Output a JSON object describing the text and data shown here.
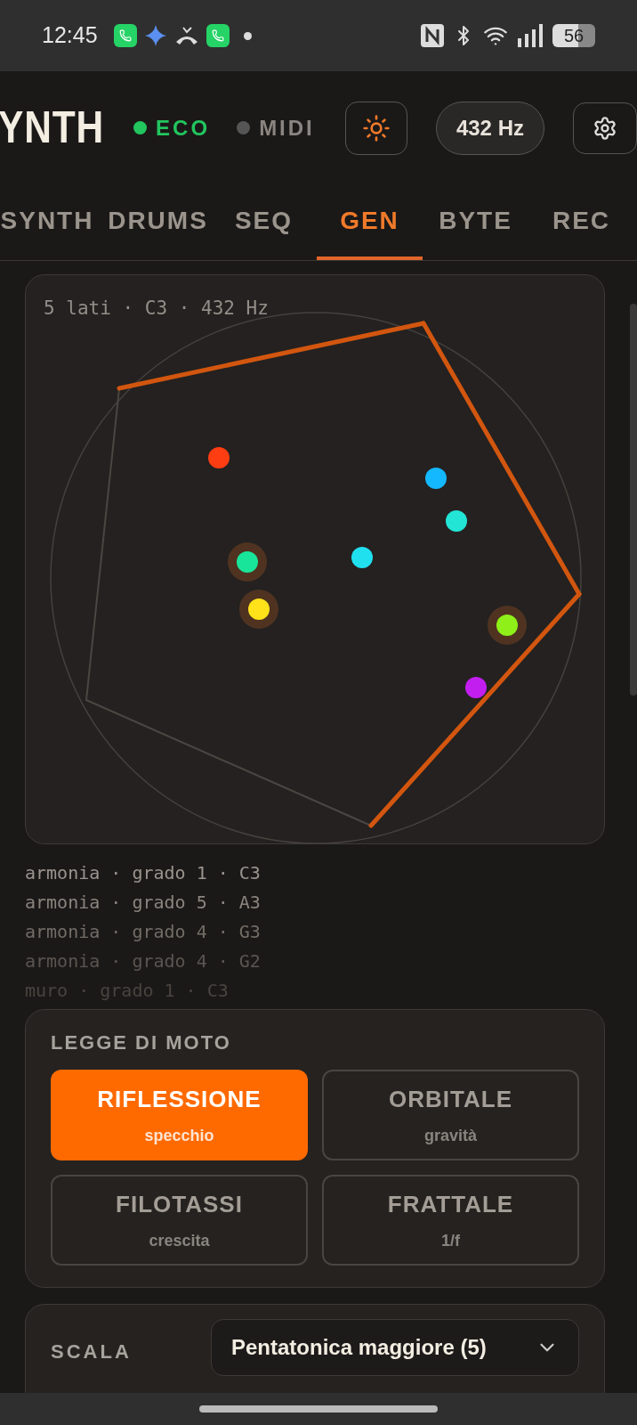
{
  "status_bar": {
    "time": "12:45",
    "battery": "56"
  },
  "header": {
    "title": "YNTH",
    "indicators": [
      {
        "label": "ECO",
        "on": true
      },
      {
        "label": "MIDI",
        "on": false
      }
    ],
    "tuning": "432 Hz"
  },
  "tabs": [
    {
      "label": "SYNTH",
      "selected": false
    },
    {
      "label": "DRUMS",
      "selected": false
    },
    {
      "label": "SEQ",
      "selected": false
    },
    {
      "label": "GEN",
      "selected": true
    },
    {
      "label": "BYTE",
      "selected": false
    },
    {
      "label": "REC",
      "selected": false
    }
  ],
  "visual": {
    "caption": "5 lati · C3 · 432 Hz"
  },
  "log": [
    "armonia · grado 1 · C3",
    "armonia · grado 5 · A3",
    "armonia · grado 4 · G3",
    "armonia · grado 4 · G2",
    "muro · grado 1 · C3"
  ],
  "motion": {
    "title": "LEGGE DI MOTO",
    "options": [
      {
        "label": "RIFLESSIONE",
        "sub": "specchio",
        "selected": true
      },
      {
        "label": "ORBITALE",
        "sub": "gravità",
        "selected": false
      },
      {
        "label": "FILOTASSI",
        "sub": "crescita",
        "selected": false
      },
      {
        "label": "FRATTALE",
        "sub": "1/f",
        "selected": false
      }
    ]
  },
  "scale": {
    "label": "SCALA",
    "value": "Pentatonica maggiore (5)"
  }
}
